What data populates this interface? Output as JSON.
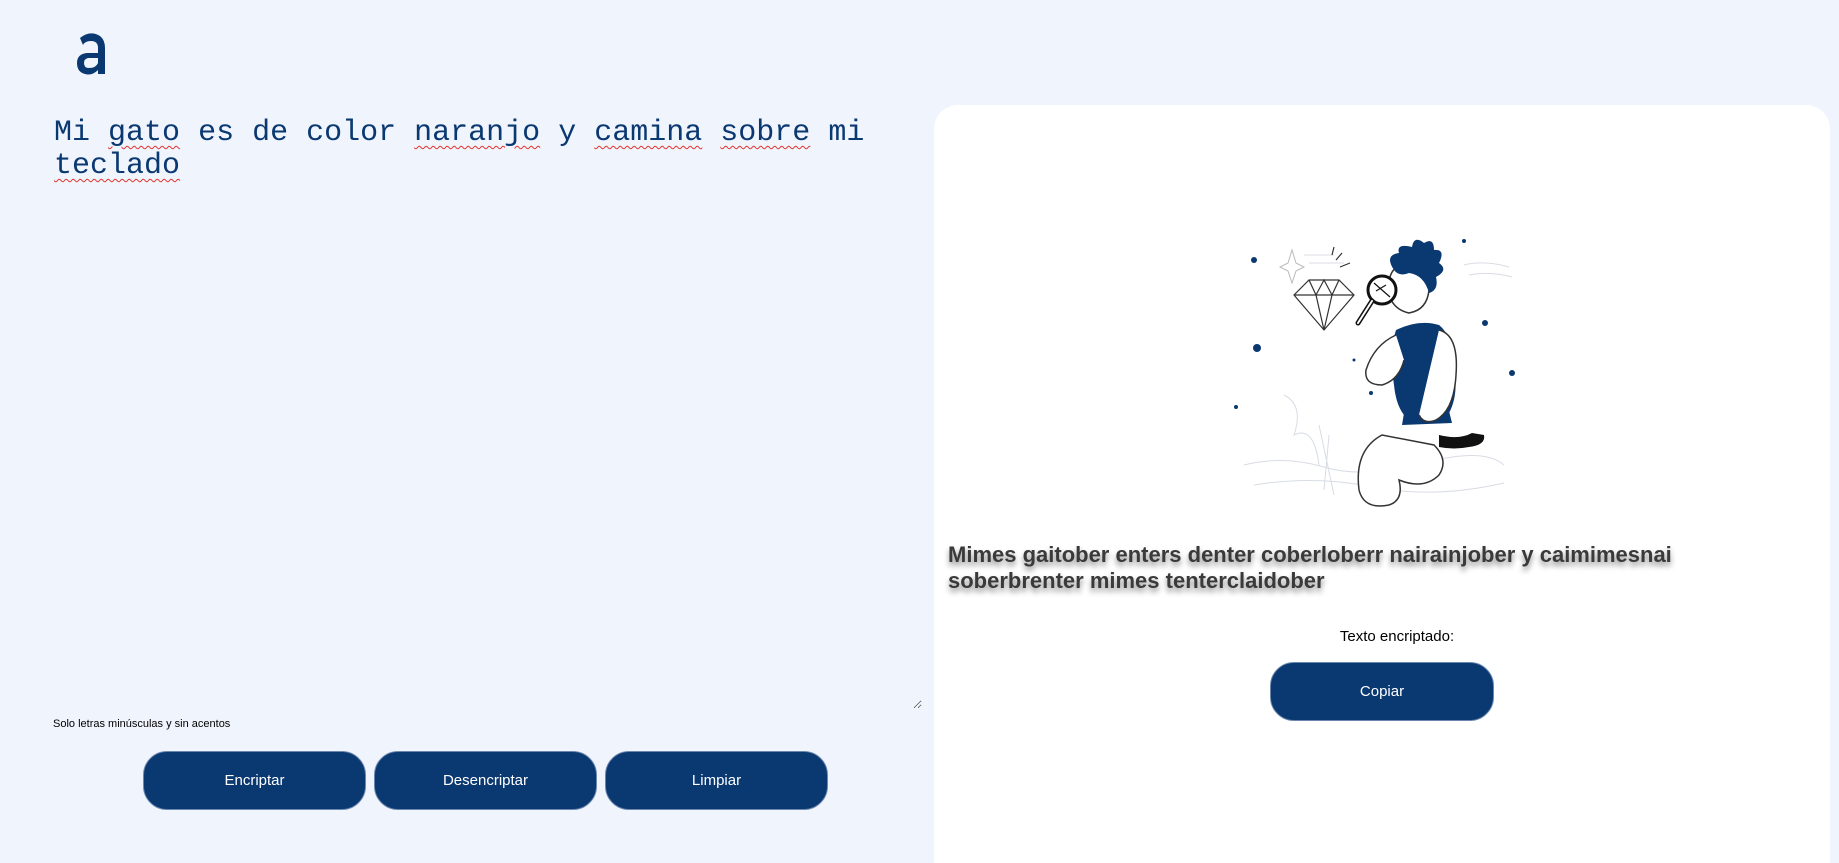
{
  "logo": {
    "icon": "alura-logo-icon",
    "color": "#0a3871"
  },
  "input": {
    "words": [
      "Mi",
      "gato",
      "es",
      "de",
      "color",
      "naranjo",
      "y",
      "camina",
      "sobre",
      "mi",
      "teclado"
    ]
  },
  "hint": {
    "icon": "info-icon",
    "text": "Solo letras minúsculas y sin acentos"
  },
  "buttons": {
    "encrypt": "Encriptar",
    "decrypt": "Desencriptar",
    "clear": "Limpiar",
    "copy": "Copiar"
  },
  "output": {
    "result": "Mimes gaitober enters denter coberloberr nairainjober y caimimesnai soberbrenter mimes tenterclaidober",
    "label": "Texto encriptado:",
    "illustration": "person-with-magnifier-illustration"
  },
  "colors": {
    "brand": "#0a3871",
    "background": "#f0f4fc",
    "panel": "#ffffff",
    "spellcheck": "#e0332f"
  }
}
